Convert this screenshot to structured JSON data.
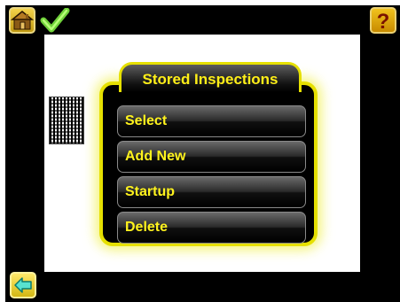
{
  "top_bar": {
    "home_icon": "home-icon",
    "status_icon": "checkmark-icon",
    "help_icon": "question-mark-icon"
  },
  "bottom_bar": {
    "back_icon": "back-arrow-icon"
  },
  "dialog": {
    "title": "Stored Inspections",
    "items": [
      {
        "label": "Select"
      },
      {
        "label": "Add New"
      },
      {
        "label": "Startup"
      },
      {
        "label": "Delete"
      }
    ]
  },
  "colors": {
    "accent": "#ffef18",
    "border": "#e6e000",
    "background": "#000000",
    "viewport": "#ffffff"
  }
}
